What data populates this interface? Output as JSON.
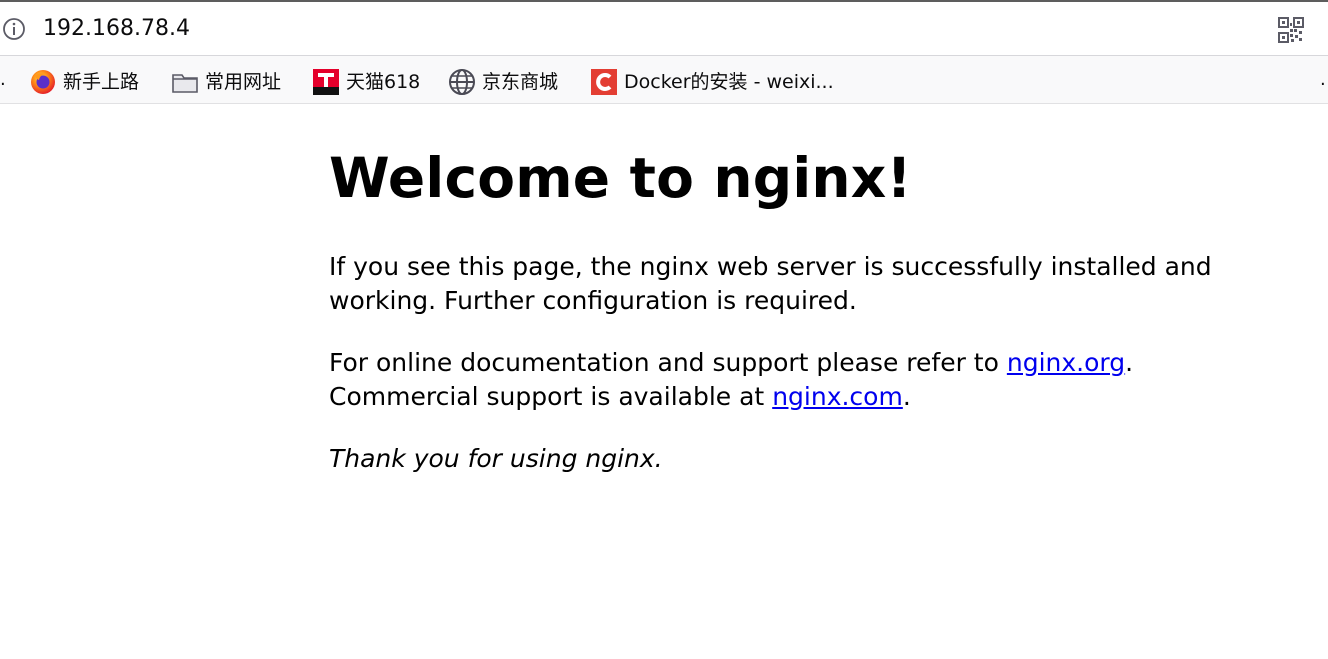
{
  "browser": {
    "address_bar": {
      "url": "192.168.78.4",
      "info_icon": "info-icon",
      "qr_icon": "qr-code-icon"
    },
    "bookmarks": {
      "overflow_left": ".",
      "overflow_right": ".",
      "items": [
        {
          "label": "新手上路",
          "icon": "firefox-icon"
        },
        {
          "label": "常用网址",
          "icon": "folder-icon"
        },
        {
          "label": "天猫618",
          "icon": "tmall-icon"
        },
        {
          "label": "京东商城",
          "icon": "globe-icon"
        },
        {
          "label": "Docker的安装 - weixi...",
          "icon": "csdn-icon"
        }
      ]
    }
  },
  "page": {
    "heading": "Welcome to nginx!",
    "para1_line1": "If you see this page, the nginx web server is successfully installed and",
    "para1_line2": "working. Further configuration is required.",
    "para2_prefix": "For online documentation and support please refer to ",
    "para2_link1": "nginx.org",
    "para2_mid": ".",
    "para2_line2_prefix": "Commercial support is available at ",
    "para2_link2": "nginx.com",
    "para2_suffix": ".",
    "thanks": "Thank you for using nginx."
  },
  "colors": {
    "link": "#0000ee",
    "text": "#000000",
    "toolbar_bg": "#f9f9fa",
    "tmall_red": "#e4002b",
    "csdn_red": "#e33e33"
  }
}
